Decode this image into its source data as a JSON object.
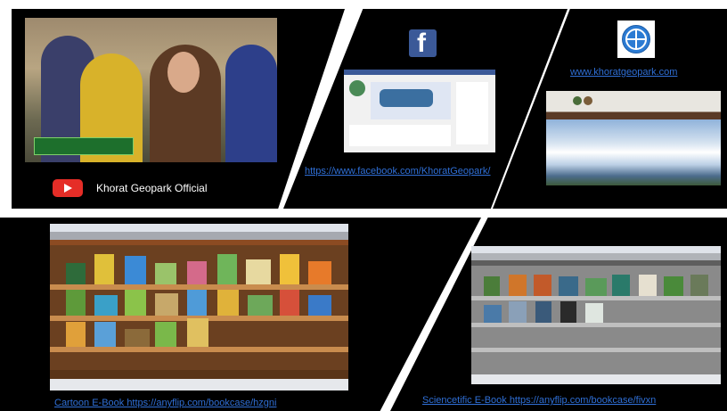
{
  "youtube": {
    "channel_name": "Khorat Geopark Official",
    "icon": "youtube-icon"
  },
  "facebook": {
    "icon": "facebook-icon",
    "icon_glyph": "f",
    "url": "https://www.facebook.com/KhoratGeopark/"
  },
  "website": {
    "icon": "globe-icon",
    "url": "www.khoratgeopark.com"
  },
  "ebooks": {
    "cartoon_link": "Cartoon E-Book    https://anyflip.com/bookcase/hzgni",
    "science_link": "Sciencetific E-Book    https://anyflip.com/bookcase/fivxn"
  },
  "colors": {
    "panel_background": "#000000",
    "divider": "#ffffff",
    "link": "#2f6fd6",
    "youtube_red": "#e52d27",
    "facebook_blue": "#3b5998"
  }
}
